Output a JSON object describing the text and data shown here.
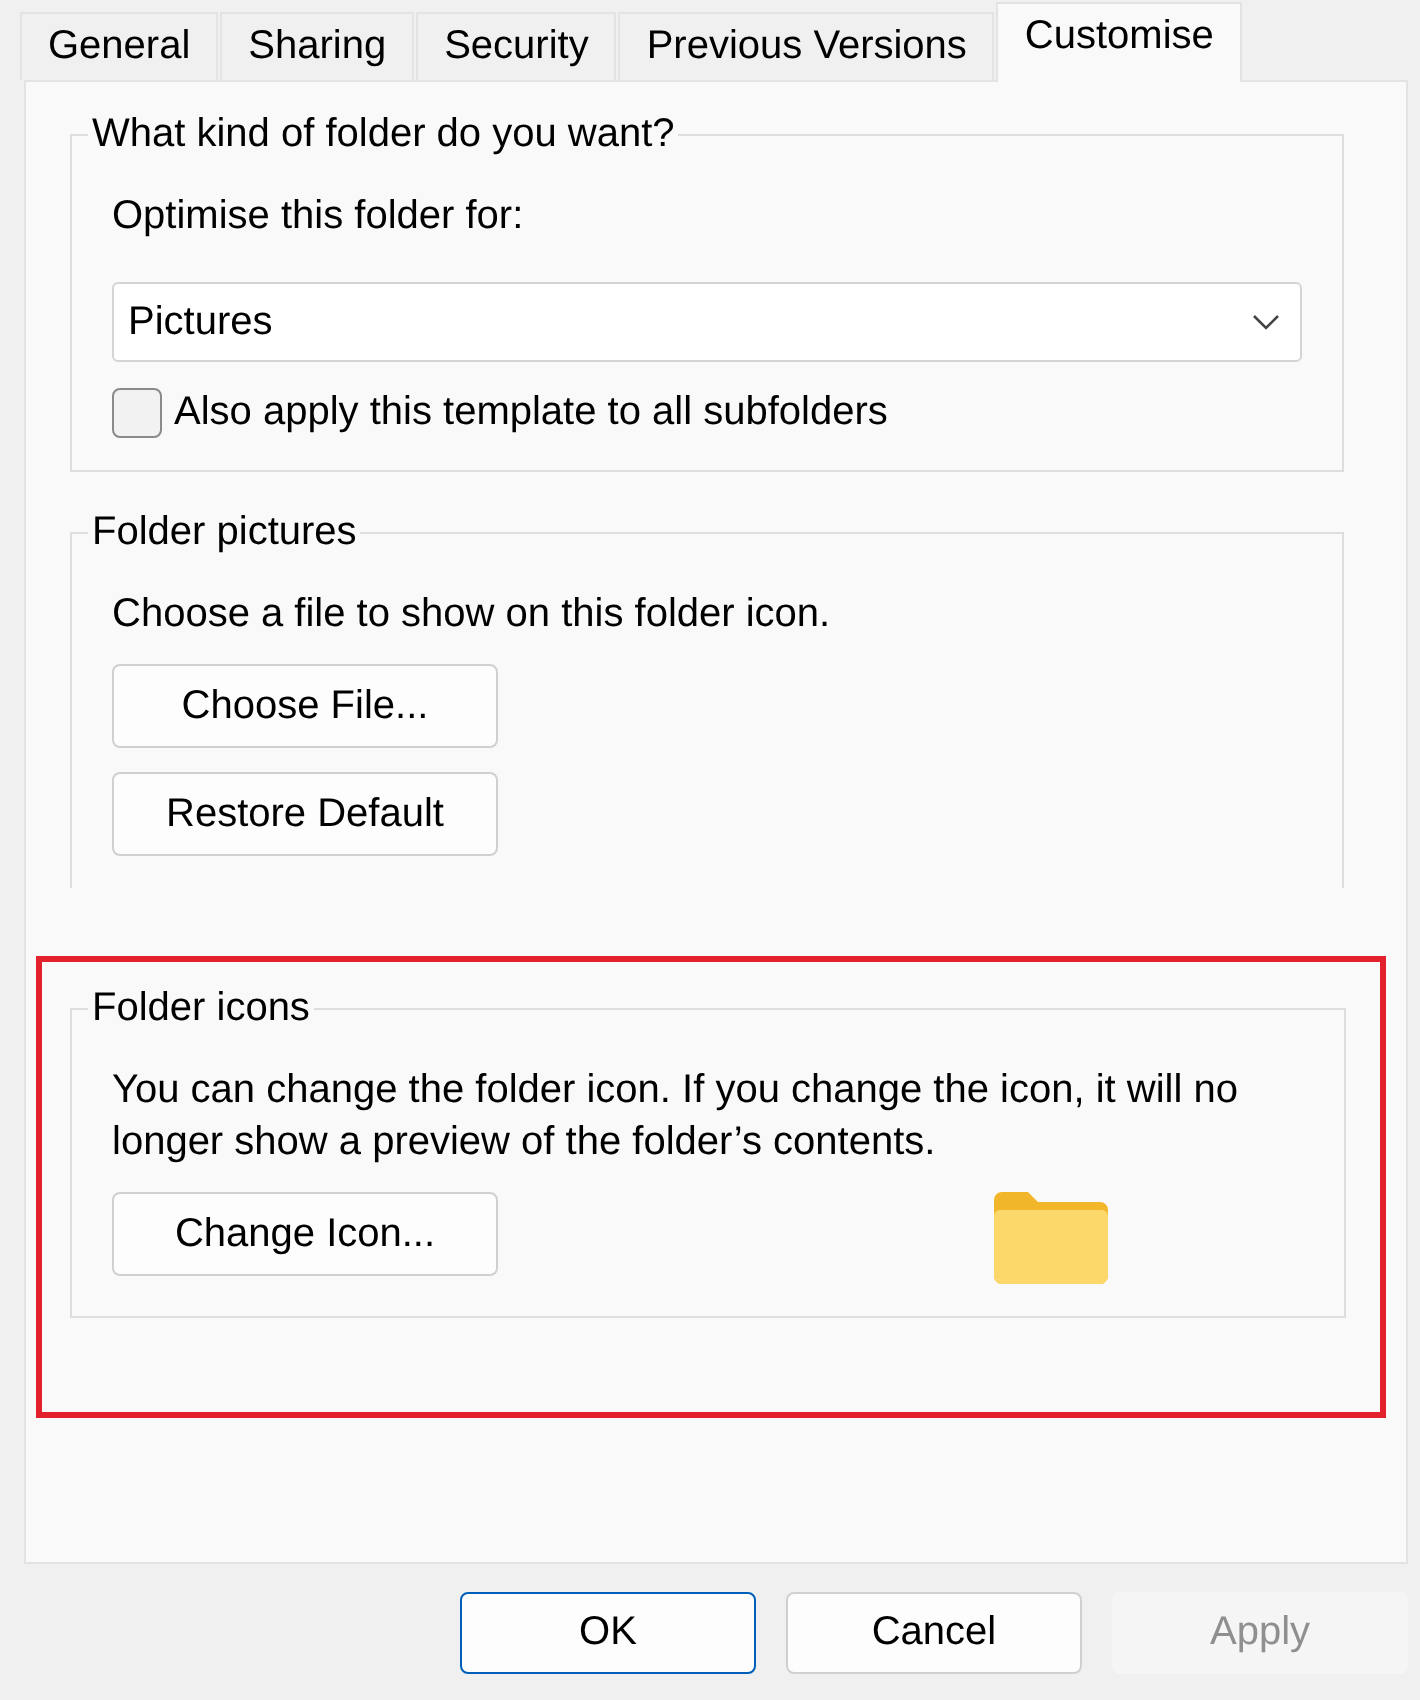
{
  "tabs": [
    {
      "label": "General",
      "selected": false
    },
    {
      "label": "Sharing",
      "selected": false
    },
    {
      "label": "Security",
      "selected": false
    },
    {
      "label": "Previous Versions",
      "selected": false
    },
    {
      "label": "Customise",
      "selected": true
    }
  ],
  "groups": [
    {
      "title": "What kind of folder do you want?",
      "highlighted": false,
      "items": [
        {
          "kind": "label",
          "text": "Optimise this folder for:"
        },
        {
          "kind": "dropdown",
          "value": "Pictures"
        },
        {
          "kind": "checkbox",
          "label": "Also apply this template to all subfolders",
          "checked": false
        }
      ]
    },
    {
      "title": "Folder pictures",
      "highlighted": false,
      "open_bottom": true,
      "items": [
        {
          "kind": "label",
          "text": "Choose a file to show on this folder icon."
        },
        {
          "kind": "button",
          "label": "Choose File..."
        },
        {
          "kind": "button",
          "label": "Restore Default"
        }
      ]
    },
    {
      "title": "Folder icons",
      "highlighted": true,
      "items": [
        {
          "kind": "label",
          "text": "You can change the folder icon. If you change the icon, it will no longer show a preview of the folder’s contents."
        },
        {
          "kind": "button_with_icon",
          "label": "Change Icon..."
        }
      ]
    }
  ],
  "buttons": [
    {
      "label": "OK",
      "default": true,
      "disabled": false
    },
    {
      "label": "Cancel",
      "default": false,
      "disabled": false
    },
    {
      "label": "Apply",
      "default": false,
      "disabled": true
    }
  ]
}
